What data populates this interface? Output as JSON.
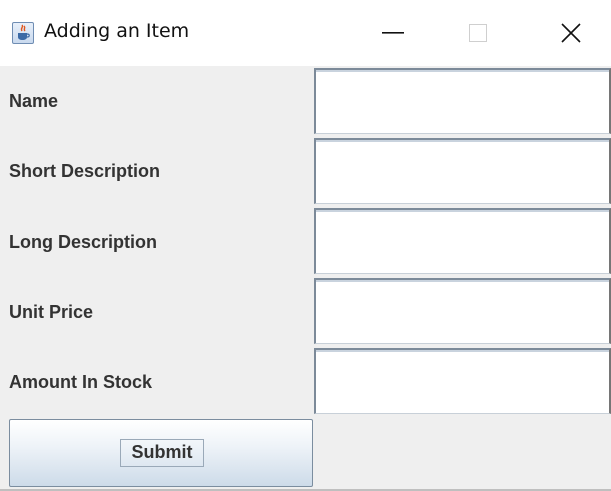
{
  "window": {
    "title": "Adding an Item",
    "icon": "java-coffee-cup-icon",
    "controls": {
      "minimize": "minimize-icon",
      "maximize": "maximize-icon",
      "close": "close-icon"
    }
  },
  "form": {
    "fields": [
      {
        "label": "Name",
        "value": ""
      },
      {
        "label": "Short Description",
        "value": ""
      },
      {
        "label": "Long Description",
        "value": ""
      },
      {
        "label": "Unit Price",
        "value": ""
      },
      {
        "label": "Amount In Stock",
        "value": ""
      }
    ],
    "submit_label": "Submit"
  }
}
